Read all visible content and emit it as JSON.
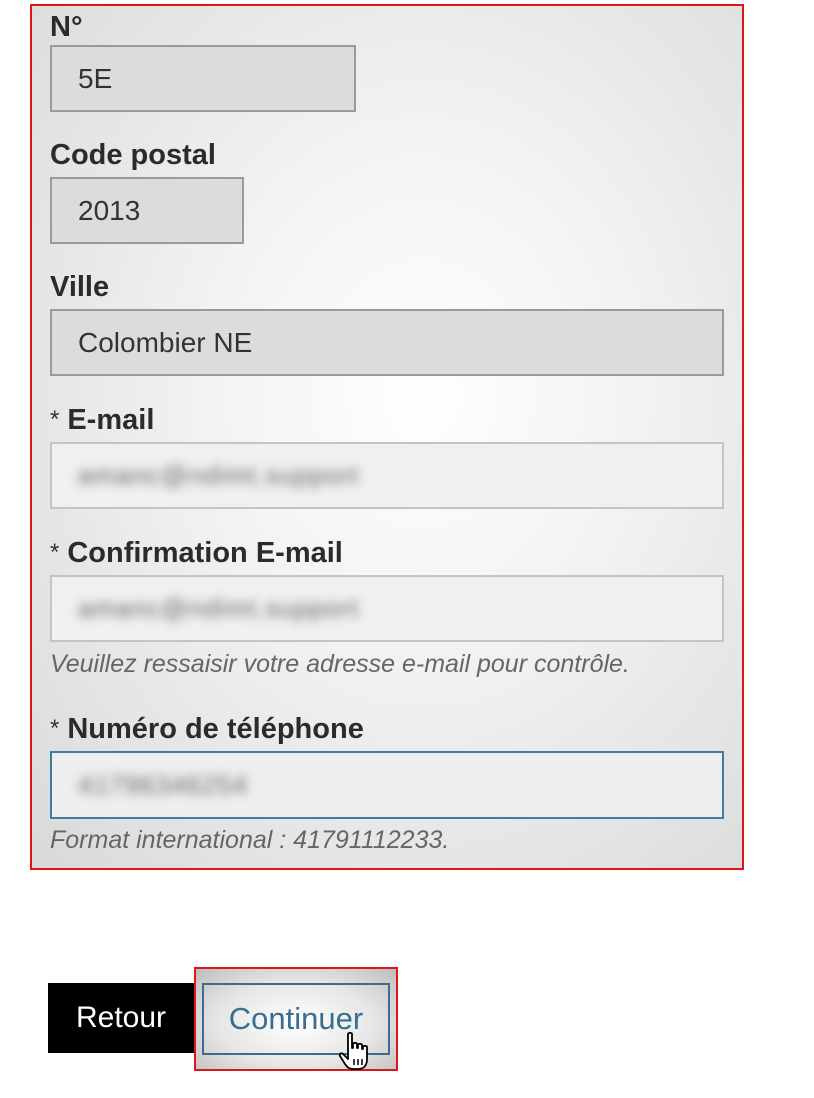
{
  "form": {
    "numero": {
      "label": "N°",
      "value": "5E"
    },
    "code_postal": {
      "label": "Code postal",
      "value": "2013"
    },
    "ville": {
      "label": "Ville",
      "value": "Colombier NE"
    },
    "email": {
      "required_mark": "*",
      "label": "E-mail",
      "value": "amanc@ndimt.support"
    },
    "email_confirm": {
      "required_mark": "*",
      "label": "Confirmation E-mail",
      "value": "amanc@ndimt.support",
      "hint": "Veuillez ressaisir votre adresse e-mail pour contrôle."
    },
    "telephone": {
      "required_mark": "*",
      "label": "Numéro de téléphone",
      "value": "41796346254",
      "hint": "Format international : 41791112233."
    }
  },
  "actions": {
    "back_label": "Retour",
    "continue_label": "Continuer"
  },
  "colors": {
    "highlight": "#e0141b",
    "focus_border": "#3b7ea1",
    "continue_text": "#3b6d8e"
  },
  "icons": {
    "cursor": "hand-pointer-icon"
  }
}
